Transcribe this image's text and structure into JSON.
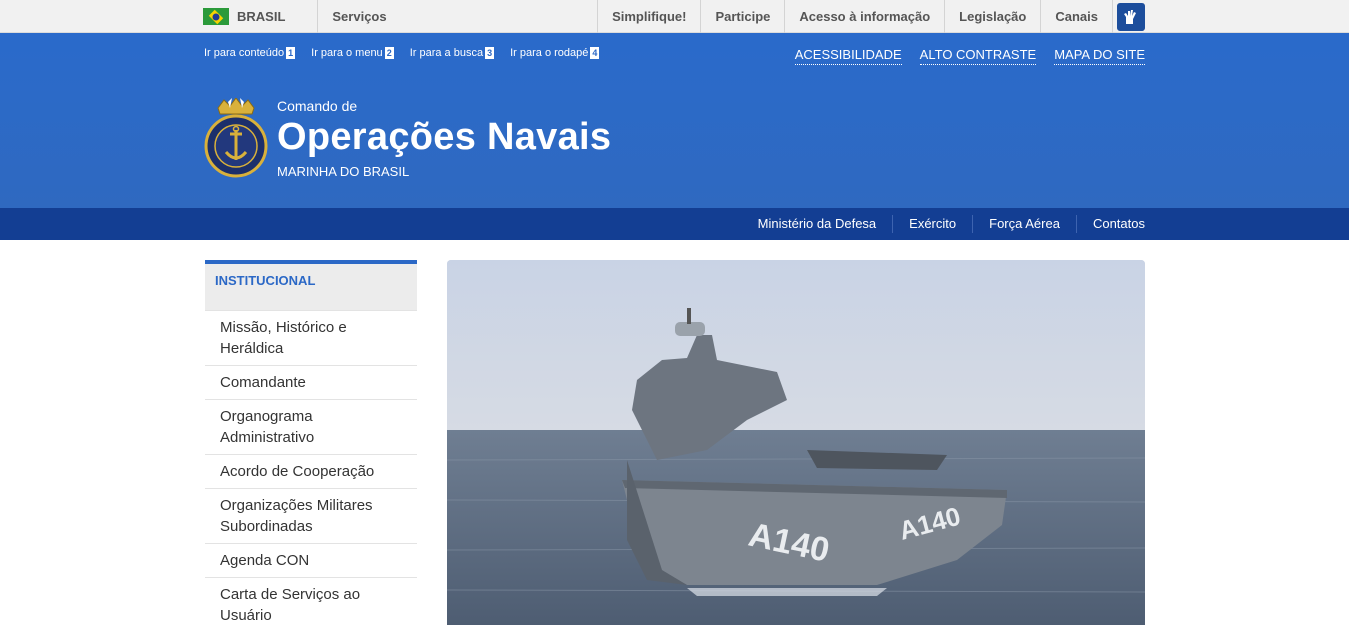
{
  "govbar": {
    "country": "BRASIL",
    "services": "Serviços",
    "links": [
      "Simplifique!",
      "Participe",
      "Acesso à informação",
      "Legislação",
      "Canais"
    ],
    "vlibras_icon": "sign-language-icon"
  },
  "skip_links": [
    {
      "label": "Ir para conteúdo",
      "key": "1"
    },
    {
      "label": "Ir para o menu",
      "key": "2"
    },
    {
      "label": "Ir para a busca",
      "key": "3"
    },
    {
      "label": "Ir para o rodapé",
      "key": "4"
    }
  ],
  "accessibility": {
    "accessibility": "ACESSIBILIDADE",
    "contrast": "ALTO CONTRASTE",
    "sitemap": "MAPA DO SITE"
  },
  "site": {
    "prefix": "Comando de",
    "name": "Operações Navais",
    "subtitle": "MARINHA DO BRASIL",
    "logo_text": "MARINHA DO BRASIL"
  },
  "nav": {
    "items": [
      "Ministério da Defesa",
      "Exército",
      "Força Aérea",
      "Contatos"
    ]
  },
  "sidebar": {
    "title": "INSTITUCIONAL",
    "items": [
      "Missão, Histórico e Heráldica",
      "Comandante",
      "Organograma Administrativo",
      "Acordo de Cooperação",
      "Organizações Militares Subordinadas",
      "Agenda CON",
      "Carta de Serviços ao Usuário"
    ]
  },
  "hero": {
    "hull_number": "A140",
    "colors": {
      "sky": "#cdd6e6",
      "sea": "#5d6d82",
      "ship": "#7a828c"
    }
  },
  "colors": {
    "header_blue": "#2b68c6",
    "nav_blue": "#133e93",
    "govbar_bg": "#f1f1f1"
  }
}
